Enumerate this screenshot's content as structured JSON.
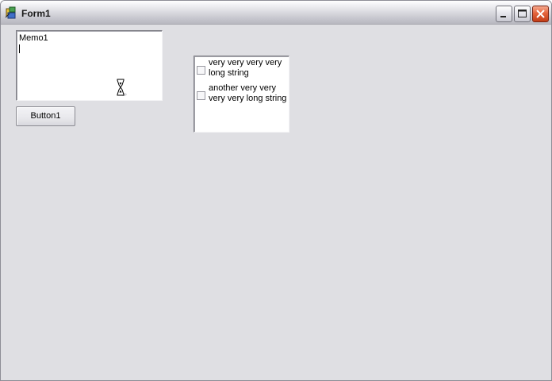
{
  "window": {
    "title": "Form1",
    "controls": {
      "minimize": "minimize",
      "maximize": "maximize",
      "close": "close"
    }
  },
  "memo": {
    "lines": [
      "Memo1",
      ""
    ]
  },
  "button1": {
    "label": "Button1"
  },
  "checklist": {
    "items": [
      {
        "label": "very very very very long string",
        "checked": false
      },
      {
        "label": "another very very very very long string",
        "checked": false
      }
    ]
  },
  "colors": {
    "form_background": "#dfdfe3",
    "close_button": "#d24a22"
  },
  "icons": [
    "app-icon",
    "minimize-icon",
    "maximize-icon",
    "close-icon",
    "hourglass-cursor-icon"
  ]
}
